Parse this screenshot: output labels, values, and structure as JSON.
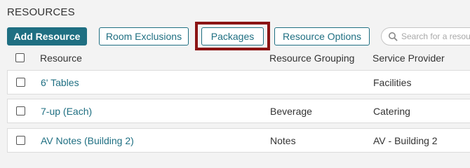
{
  "section": {
    "title": "RESOURCES"
  },
  "toolbar": {
    "add_resource_label": "Add Resource",
    "room_exclusions_label": "Room Exclusions",
    "packages_label": "Packages",
    "resource_options_label": "Resource Options"
  },
  "search": {
    "placeholder": "Search for a resource",
    "value": ""
  },
  "colors": {
    "accent": "#1f6f82",
    "highlight": "#8b1414"
  },
  "table": {
    "headers": {
      "resource": "Resource",
      "grouping": "Resource Grouping",
      "provider": "Service Provider"
    },
    "rows": [
      {
        "resource": "6' Tables",
        "grouping": "",
        "provider": "Facilities"
      },
      {
        "resource": "7-up (Each)",
        "grouping": "Beverage",
        "provider": "Catering"
      },
      {
        "resource": "AV Notes (Building 2)",
        "grouping": "Notes",
        "provider": "AV - Building 2"
      }
    ]
  }
}
